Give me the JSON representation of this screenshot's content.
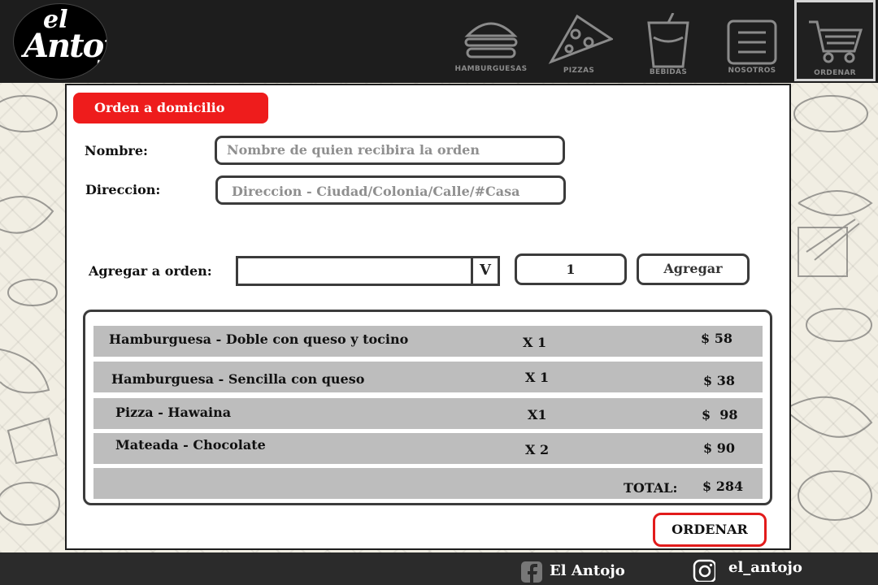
{
  "brand": {
    "logo_top": "el",
    "logo_main": "Antojo"
  },
  "nav": [
    {
      "label": "HAMBURGUESAS",
      "icon": "burger-icon"
    },
    {
      "label": "PIZZAS",
      "icon": "pizza-icon"
    },
    {
      "label": "BEBIDAS",
      "icon": "drink-icon"
    },
    {
      "label": "NOSOTROS",
      "icon": "menu-icon"
    },
    {
      "label": "ORDENAR",
      "icon": "cart-icon",
      "active": true
    }
  ],
  "form": {
    "title": "Orden a domicilio",
    "name_label": "Nombre:",
    "name_placeholder": "Nombre de quien recibira la orden",
    "address_label": "Direccion:",
    "address_placeholder": "Direccion -   Ciudad/Colonia/Calle/#Casa",
    "add_label": "Agregar a orden:",
    "select_arrow": "V",
    "quantity": "1",
    "add_button": "Agregar"
  },
  "order": {
    "items": [
      {
        "name": "Hamburguesa - Doble con queso y tocino",
        "qty": "X 1",
        "price": "$ 58"
      },
      {
        "name": "Hamburguesa - Sencilla con queso",
        "qty": "X 1",
        "price": "$ 38"
      },
      {
        "name": "Pizza - Hawaina",
        "qty": "X1",
        "price": "$  98"
      },
      {
        "name": "Mateada - Chocolate",
        "qty": "X 2",
        "price": "$ 90"
      }
    ],
    "total_label": "TOTAL:",
    "total_value": "$ 284",
    "order_button": "ORDENAR"
  },
  "footer": {
    "facebook": "El Antojo",
    "instagram": "el_antojo"
  },
  "colors": {
    "accent": "#ee1c1c",
    "header_bg": "#1d1d1d",
    "row_bg": "#bdbdbd"
  }
}
